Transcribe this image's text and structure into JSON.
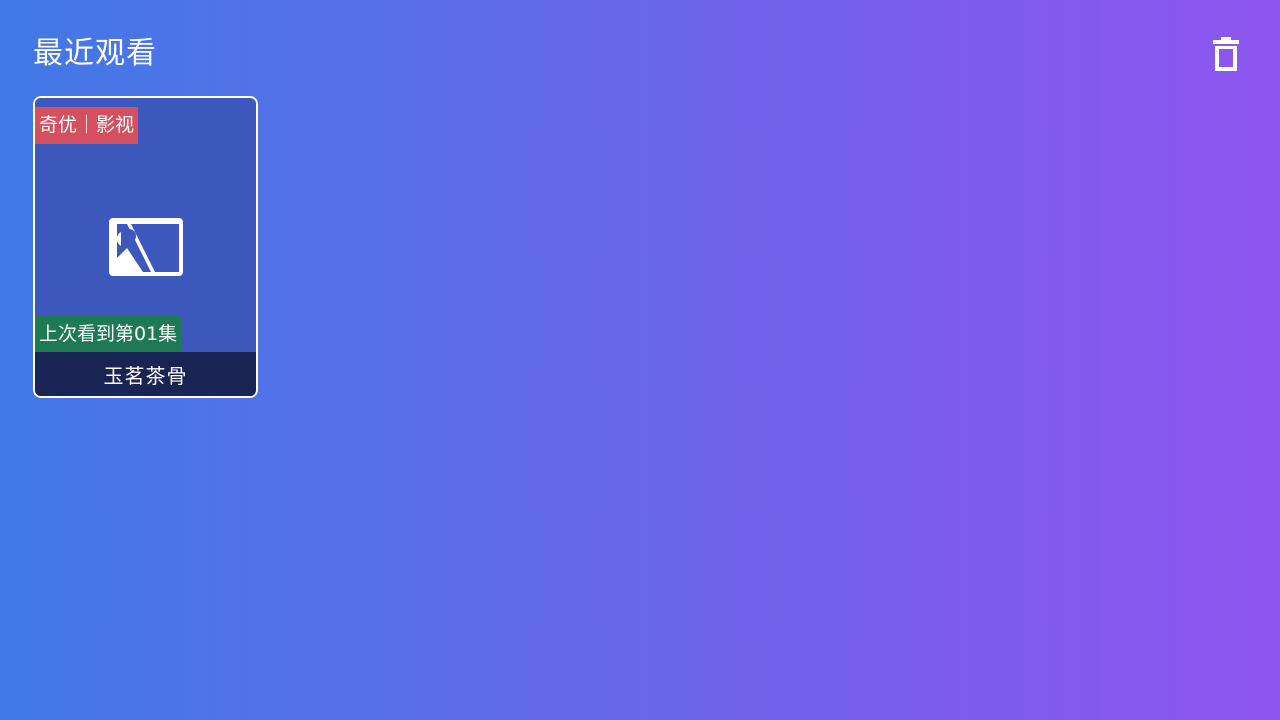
{
  "header": {
    "title": "最近观看",
    "clear_icon": "trash-icon"
  },
  "history": {
    "items": [
      {
        "source": "奇优｜影视",
        "progress": "上次看到第01集",
        "title": "玉茗茶骨",
        "poster_icon": "image-placeholder-icon"
      }
    ]
  },
  "colors": {
    "background_start": "#4178e6",
    "background_end": "#8e56ee",
    "source_badge": "#d4505e",
    "progress_badge": "#1e7a55",
    "title_bar": "#1a2454",
    "poster": "#3d58bd"
  }
}
